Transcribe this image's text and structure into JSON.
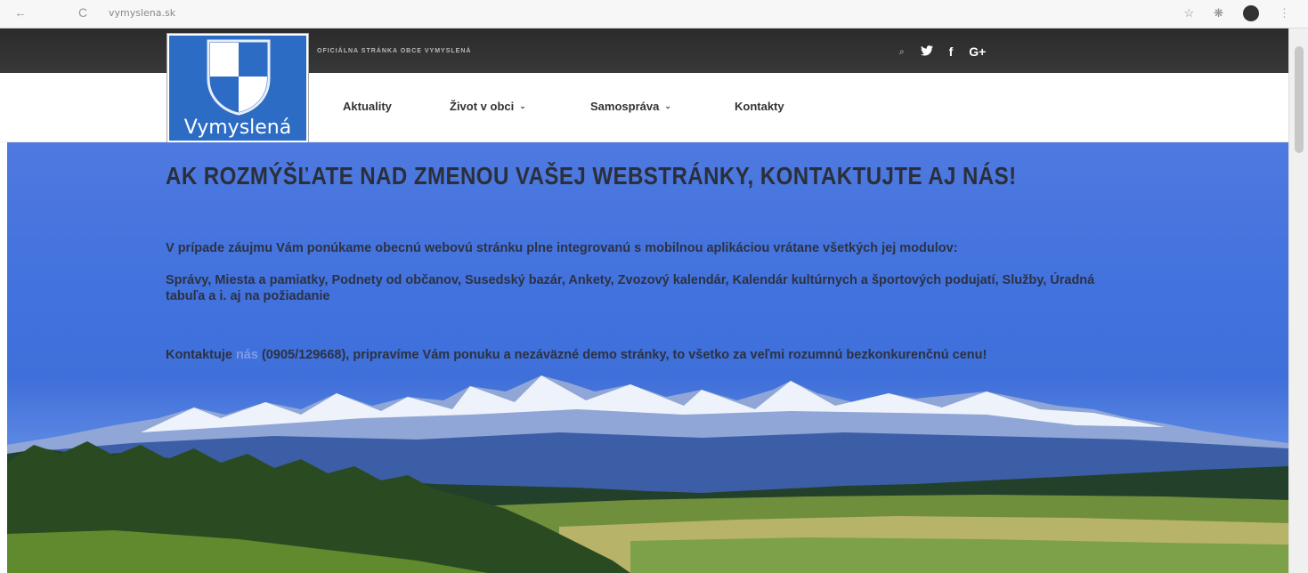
{
  "browser": {
    "back_icon": "←",
    "reload_icon": "C",
    "url": "vymyslena.sk",
    "star_icon": "☆",
    "extension_icon": "❋",
    "menu_icon": "⋮"
  },
  "topbar": {
    "slogan": "OFICIÁLNA STRÁNKA OBCE VYMYSLENÁ",
    "search_icon": "⌕",
    "twitter": "🐦",
    "facebook": "f",
    "google": "G+"
  },
  "logo": {
    "text": "Vymyslená",
    "colors": {
      "blue": "#2c6cc4",
      "white": "#ffffff"
    }
  },
  "nav": {
    "items": [
      {
        "label": "Aktuality",
        "caret": ""
      },
      {
        "label": "Život v obci",
        "caret": "⌄"
      },
      {
        "label": "Samospráva",
        "caret": "⌄"
      },
      {
        "label": "Kontakty",
        "caret": ""
      }
    ]
  },
  "hero": {
    "title": "AK ROZMÝŠĽATE NAD ZMENOU VAŠEJ WEBSTRÁNKY, KONTAKTUJTE AJ NÁS!",
    "p1": "V prípade záujmu Vám ponúkame obecnú webovú stránku plne integrovanú s mobilnou aplikáciou vrátane všetkých jej modulov:",
    "p2": "Správy, Miesta a pamiatky, Podnety od občanov, Susedský bazár, Ankety, Zvozový kalendár, Kalendár kultúrnych a športových podujatí, Služby, Úradná tabuľa a i. aj na požiadanie",
    "p3_before": "Kontaktuje ",
    "p3_link": "nás",
    "p3_after": " (0905/129668), pripravíme Vám ponuku a nezáväzné demo stránky, to všetko za veľmi rozumnú bezkonkurenčnú cenu!"
  }
}
